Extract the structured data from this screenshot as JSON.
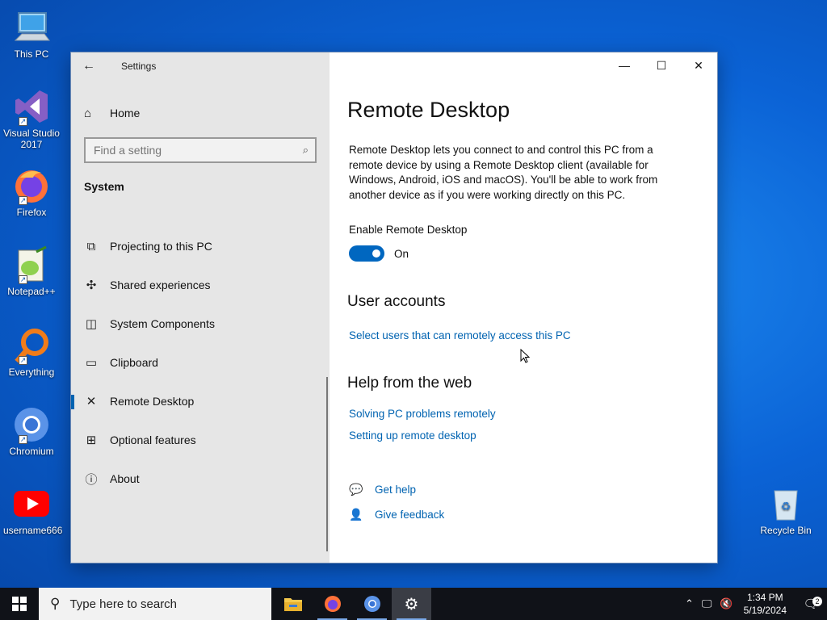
{
  "desktop": {
    "icons": [
      {
        "label": "This PC",
        "icon": "computer-icon"
      },
      {
        "label": "Visual Studio 2017",
        "icon": "visual-studio-icon"
      },
      {
        "label": "Firefox",
        "icon": "firefox-icon"
      },
      {
        "label": "Notepad++",
        "icon": "notepadpp-icon"
      },
      {
        "label": "Everything",
        "icon": "everything-search-icon"
      },
      {
        "label": "Chromium",
        "icon": "chromium-icon"
      },
      {
        "label": "username666",
        "icon": "youtube-icon"
      },
      {
        "label": "Recycle Bin",
        "icon": "recycle-bin-icon"
      }
    ]
  },
  "window": {
    "app_title": "Settings",
    "nav": {
      "home_label": "Home",
      "search_placeholder": "Find a setting",
      "section_title": "System",
      "items": [
        {
          "label": "Projecting to this PC",
          "icon": "projector-icon"
        },
        {
          "label": "Shared experiences",
          "icon": "shared-experiences-icon"
        },
        {
          "label": "System Components",
          "icon": "components-icon"
        },
        {
          "label": "Clipboard",
          "icon": "clipboard-icon"
        },
        {
          "label": "Remote Desktop",
          "icon": "remote-desktop-icon",
          "selected": true
        },
        {
          "label": "Optional features",
          "icon": "optional-features-icon"
        },
        {
          "label": "About",
          "icon": "info-icon"
        }
      ]
    },
    "content": {
      "title": "Remote Desktop",
      "description": "Remote Desktop lets you connect to and control this PC from a remote device by using a Remote Desktop client (available for Windows, Android, iOS and macOS). You'll be able to work from another device as if you were working directly on this PC.",
      "enable_label": "Enable Remote Desktop",
      "toggle_state": "On",
      "user_accounts_heading": "User accounts",
      "select_users_link": "Select users that can remotely access this PC",
      "help_heading": "Help from the web",
      "help_links": [
        "Solving PC problems remotely",
        "Setting up remote desktop"
      ],
      "get_help": "Get help",
      "give_feedback": "Give feedback"
    }
  },
  "taskbar": {
    "search_placeholder": "Type here to search",
    "apps": [
      "file-explorer-icon",
      "firefox-icon",
      "chromium-icon",
      "settings-gear-icon"
    ],
    "time": "1:34 PM",
    "date": "5/19/2024",
    "notification_count": "2"
  },
  "colors": {
    "accent": "#0067c0",
    "link": "#0063b1",
    "nav_bg": "#e6e6e6",
    "taskbar_bg": "#101218"
  }
}
